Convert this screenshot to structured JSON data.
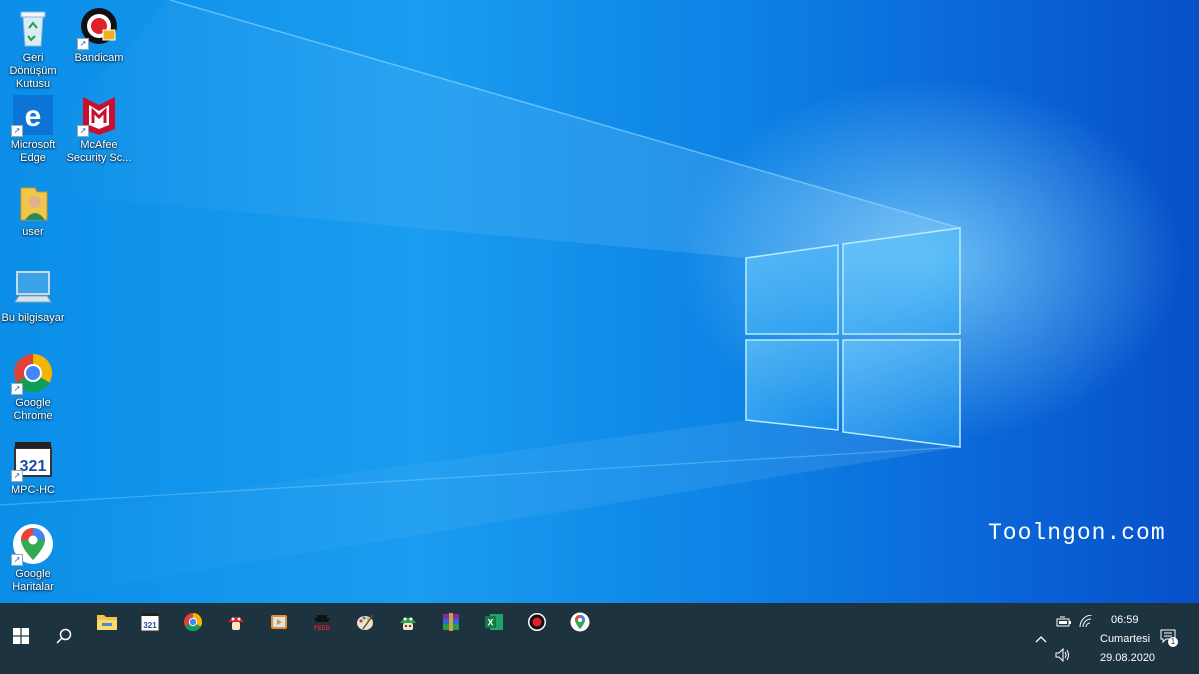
{
  "desktop": {
    "icons": [
      {
        "label": "Geri\nDönüşüm\nKutusu",
        "icon": "recycle-bin-icon"
      },
      {
        "label": "Bandicam",
        "icon": "bandicam-icon"
      },
      {
        "label": "Microsoft\nEdge",
        "icon": "edge-icon"
      },
      {
        "label": "McAfee\nSecurity Sc...",
        "icon": "mcafee-icon"
      },
      {
        "label": "user",
        "icon": "user-folder-icon"
      },
      {
        "label": "Bu bilgisayar",
        "icon": "computer-icon"
      },
      {
        "label": "Google\nChrome",
        "icon": "chrome-icon"
      },
      {
        "label": "MPC-HC",
        "icon": "mpc-hc-icon"
      },
      {
        "label": "Google\nHaritalar",
        "icon": "google-maps-icon"
      }
    ],
    "watermark": "Toolngon.com"
  },
  "taskbar": {
    "start_icon": "windows-start-icon",
    "search_icon": "search-icon",
    "pinned": [
      {
        "name": "file-explorer-icon"
      },
      {
        "name": "mpc-hc-icon"
      },
      {
        "name": "chrome-icon"
      },
      {
        "name": "mushroom-app-icon"
      },
      {
        "name": "media-player-icon"
      },
      {
        "name": "feed-app-icon"
      },
      {
        "name": "paint-icon"
      },
      {
        "name": "green-mushroom-icon"
      },
      {
        "name": "winrar-icon"
      },
      {
        "name": "excel-icon"
      },
      {
        "name": "record-icon"
      },
      {
        "name": "google-maps-icon"
      }
    ],
    "tray": {
      "time": "06:59",
      "day": "Cumartesi",
      "date": "29.08.2020",
      "notification_count": "1"
    }
  },
  "colors": {
    "taskbar": "#1e3340",
    "accent": "#0a7fe0"
  }
}
